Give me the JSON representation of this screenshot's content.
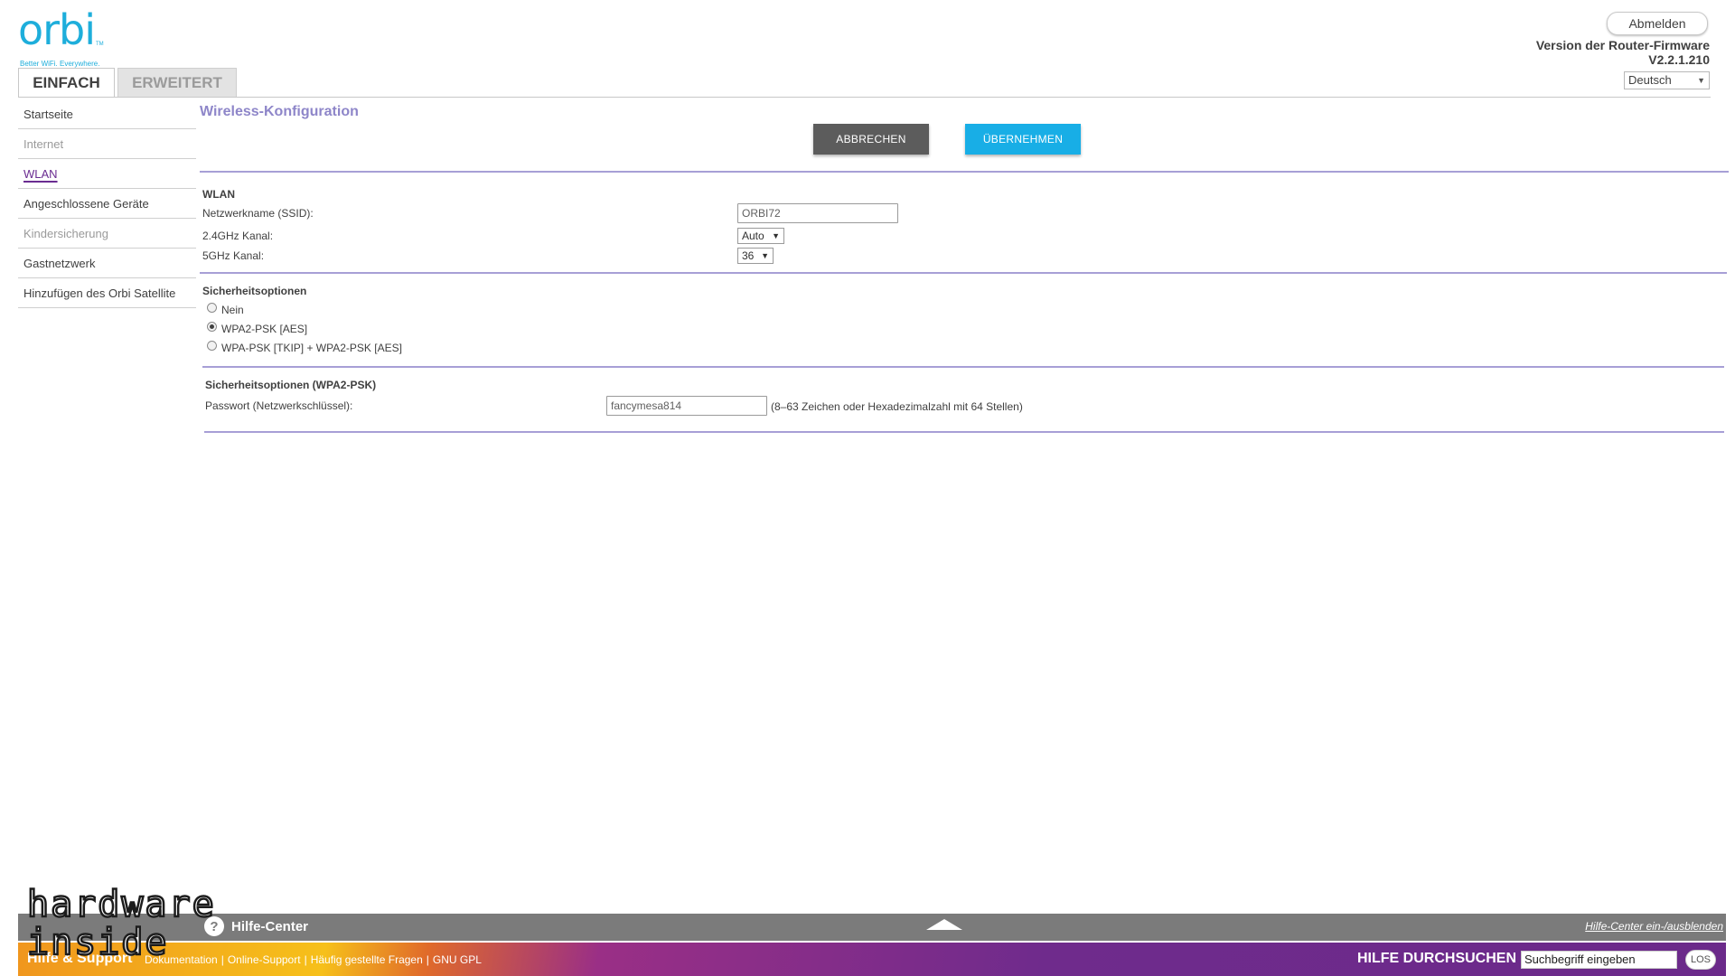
{
  "header": {
    "logo_text": "orbi",
    "logo_tm": "TM",
    "logo_tagline": "Better WiFi. Everywhere.",
    "logout_label": "Abmelden",
    "firmware_label": "Version der Router-Firmware",
    "firmware_version": "V2.2.1.210",
    "language": "Deutsch"
  },
  "tabs": [
    {
      "label": "EINFACH"
    },
    {
      "label": "ERWEITERT"
    }
  ],
  "sidebar": {
    "items": [
      {
        "label": "Startseite"
      },
      {
        "label": "Internet"
      },
      {
        "label": "WLAN"
      },
      {
        "label": "Angeschlossene Geräte"
      },
      {
        "label": "Kindersicherung"
      },
      {
        "label": "Gastnetzwerk"
      },
      {
        "label": "Hinzufügen des Orbi Satellite"
      }
    ]
  },
  "main": {
    "title": "Wireless-Konfiguration",
    "cancel_label": "ABBRECHEN",
    "apply_label": "ÜBERNEHMEN",
    "wlan": {
      "section_title": "WLAN",
      "ssid_label": "Netzwerkname (SSID):",
      "ssid_value": "ORBI72",
      "ch24_label": "2.4GHz Kanal:",
      "ch24_value": "Auto",
      "ch5_label": "5GHz Kanal:",
      "ch5_value": "36"
    },
    "security": {
      "section_title": "Sicherheitsoptionen",
      "options": [
        {
          "label": "Nein",
          "selected": false
        },
        {
          "label": "WPA2-PSK [AES]",
          "selected": true
        },
        {
          "label": "WPA-PSK [TKIP] + WPA2-PSK [AES]",
          "selected": false
        }
      ]
    },
    "wpa2": {
      "section_title": "Sicherheitsoptionen (WPA2-PSK)",
      "password_label": "Passwort (Netzwerkschlüssel):",
      "password_value": "fancymesa814",
      "password_hint": "(8–63 Zeichen oder Hexadezimalzahl mit 64 Stellen)"
    }
  },
  "footer": {
    "help_center_label": "Hilfe-Center",
    "help_toggle_label": "Hilfe-Center ein-/ausblenden",
    "support_title": "Hilfe & Support",
    "links": [
      "Dokumentation",
      "Online-Support",
      "Häufig gestellte Fragen",
      "GNU GPL"
    ],
    "search_title": "HILFE DURCHSUCHEN",
    "search_placeholder": "Suchbegriff eingeben",
    "search_button": "LOS"
  },
  "watermark": {
    "line1": "hardware",
    "line2": "inside"
  },
  "colors": {
    "accent_purple": "#8e86c9",
    "brand_blue": "#1eaedb",
    "apply_button": "#18aee6",
    "cancel_button": "#5c5c5c",
    "active_nav": "#6a2c91"
  }
}
